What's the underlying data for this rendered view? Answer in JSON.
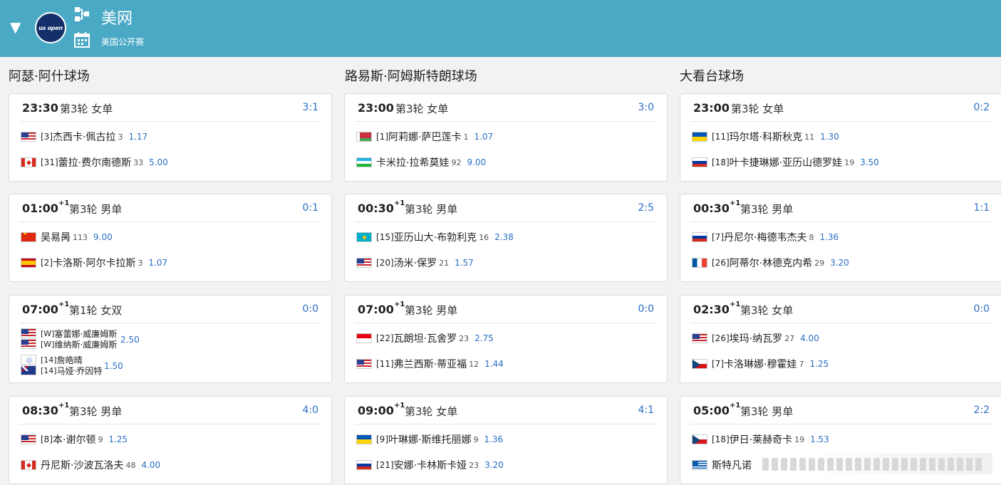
{
  "header": {
    "toggle_icon": "▼",
    "logo_text": "us open",
    "title": "美网",
    "subtitle": "美国公开赛",
    "bg_color": "#4aa9c5"
  },
  "columns": [
    {
      "title": "阿瑟·阿什球场",
      "matches": [
        {
          "time": "23:30",
          "plus": "",
          "round": "第3轮 女单",
          "score": "3:1",
          "players": [
            {
              "flag": "us",
              "seed": "[3]",
              "name": "杰西卡·佩古拉",
              "rank": "3",
              "odds": "1.17"
            },
            {
              "flag": "ca",
              "seed": "[31]",
              "name": "蕾拉·费尔南德斯",
              "rank": "33",
              "odds": "5.00"
            }
          ]
        },
        {
          "time": "01:00",
          "plus": "+1",
          "round": "第3轮 男单",
          "score": "0:1",
          "players": [
            {
              "flag": "cn",
              "seed": "",
              "name": "吴易昺",
              "rank": "113",
              "odds": "9.00"
            },
            {
              "flag": "es",
              "seed": "[2]",
              "name": "卡洛斯·阿尔卡拉斯",
              "rank": "3",
              "odds": "1.07"
            }
          ]
        },
        {
          "time": "07:00",
          "plus": "+1",
          "round": "第1轮 女双",
          "score": "0:0",
          "doubles": true,
          "teams": [
            {
              "odds": "2.50",
              "players": [
                {
                  "flag": "us",
                  "seed": "[W]",
                  "name": "塞蕾娜·威廉姆斯"
                },
                {
                  "flag": "us",
                  "seed": "[W]",
                  "name": "维纳斯·威廉姆斯"
                }
              ]
            },
            {
              "odds": "1.50",
              "players": [
                {
                  "flag": "tw",
                  "seed": "[14]",
                  "name": "詹皓晴"
                },
                {
                  "flag": "au",
                  "seed": "[14]",
                  "name": "马娅·乔因特"
                }
              ]
            }
          ]
        },
        {
          "time": "08:30",
          "plus": "+1",
          "round": "第3轮 男单",
          "score": "4:0",
          "players": [
            {
              "flag": "us",
              "seed": "[8]",
              "name": "本·谢尔顿",
              "rank": "9",
              "odds": "1.25"
            },
            {
              "flag": "ca",
              "seed": "",
              "name": "丹尼斯·沙波瓦洛夫",
              "rank": "48",
              "odds": "4.00"
            }
          ]
        }
      ]
    },
    {
      "title": "路易斯·阿姆斯特朗球场",
      "matches": [
        {
          "time": "23:00",
          "plus": "",
          "round": "第3轮 女单",
          "score": "3:0",
          "players": [
            {
              "flag": "by",
              "seed": "[1]",
              "name": "阿莉娜·萨巴莲卡",
              "rank": "1",
              "odds": "1.07"
            },
            {
              "flag": "uz",
              "seed": "",
              "name": "卡米拉·拉希莫娃",
              "rank": "92",
              "odds": "9.00"
            }
          ]
        },
        {
          "time": "00:30",
          "plus": "+1",
          "round": "第3轮 男单",
          "score": "2:5",
          "players": [
            {
              "flag": "kz",
              "seed": "[15]",
              "name": "亚历山大·布勃利克",
              "rank": "16",
              "odds": "2.38"
            },
            {
              "flag": "us",
              "seed": "[20]",
              "name": "汤米·保罗",
              "rank": "21",
              "odds": "1.57"
            }
          ]
        },
        {
          "time": "07:00",
          "plus": "+1",
          "round": "第3轮 男单",
          "score": "0:0",
          "players": [
            {
              "flag": "id",
              "seed": "[22]",
              "name": "瓦朗坦·瓦舍罗",
              "rank": "23",
              "odds": "2.75"
            },
            {
              "flag": "us",
              "seed": "[11]",
              "name": "弗兰西斯·蒂亚福",
              "rank": "12",
              "odds": "1.44"
            }
          ]
        },
        {
          "time": "09:00",
          "plus": "+1",
          "round": "第3轮 女单",
          "score": "4:1",
          "players": [
            {
              "flag": "ua",
              "seed": "[9]",
              "name": "叶琳娜·斯维托丽娜",
              "rank": "9",
              "odds": "1.36"
            },
            {
              "flag": "ru",
              "seed": "[21]",
              "name": "安娜·卡林斯卡娅",
              "rank": "23",
              "odds": "3.20"
            }
          ]
        }
      ]
    },
    {
      "title": "大看台球场",
      "matches": [
        {
          "time": "23:00",
          "plus": "",
          "round": "第3轮 女单",
          "score": "0:2",
          "players": [
            {
              "flag": "ua",
              "seed": "[11]",
              "name": "玛尔塔·科斯秋克",
              "rank": "11",
              "odds": "1.30"
            },
            {
              "flag": "ru",
              "seed": "[18]",
              "name": "叶卡捷琳娜·亚历山德罗娃",
              "rank": "19",
              "odds": "3.50"
            }
          ]
        },
        {
          "time": "00:30",
          "plus": "+1",
          "round": "第3轮 男单",
          "score": "1:1",
          "players": [
            {
              "flag": "ru",
              "seed": "[7]",
              "name": "丹尼尔·梅德韦杰夫",
              "rank": "8",
              "odds": "1.36"
            },
            {
              "flag": "fr",
              "seed": "[26]",
              "name": "阿蒂尔·林德克内希",
              "rank": "29",
              "odds": "3.20"
            }
          ]
        },
        {
          "time": "02:30",
          "plus": "+1",
          "round": "第3轮 女单",
          "score": "0:0",
          "players": [
            {
              "flag": "us",
              "seed": "[26]",
              "name": "埃玛·纳瓦罗",
              "rank": "27",
              "odds": "4.00"
            },
            {
              "flag": "cz",
              "seed": "[7]",
              "name": "卡洛琳娜·穆霍娃",
              "rank": "7",
              "odds": "1.25"
            }
          ]
        },
        {
          "time": "05:00",
          "plus": "+1",
          "round": "第3轮 男单",
          "score": "2:2",
          "players": [
            {
              "flag": "cz",
              "seed": "[18]",
              "name": "伊日·莱赫奇卡",
              "rank": "19",
              "odds": "1.53"
            },
            {
              "flag": "gr",
              "seed": "",
              "name": "斯特凡诺",
              "rank": "",
              "odds": ""
            }
          ]
        }
      ]
    }
  ]
}
